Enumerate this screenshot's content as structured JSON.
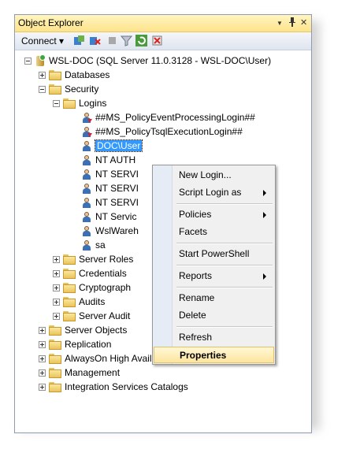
{
  "window": {
    "title": "Object Explorer",
    "dropdown_glyph": "▼",
    "pin_glyph": "ᵽ",
    "close_glyph": "✕"
  },
  "toolbar": {
    "connect_label": "Connect ▾",
    "icons": [
      "connect-object-explorer-icon",
      "disconnect-icon",
      "stop-icon",
      "filter-icon",
      "refresh-icon",
      "delete-icon"
    ]
  },
  "tree": {
    "server": "WSL-DOC (SQL Server 11.0.3128 - WSL-DOC\\User)",
    "nodes": {
      "databases": "Databases",
      "security": "Security",
      "logins": "Logins",
      "login_items": [
        "##MS_PolicyEventProcessingLogin##",
        "##MS_PolicyTsqlExecutionLogin##",
        "DOC\\User",
        "NT AUTH",
        "NT SERVI",
        "NT SERVI",
        "NT SERVI",
        "NT Servic",
        "WslWareh",
        "sa"
      ],
      "security_children": [
        "Server Roles",
        "Credentials",
        "Cryptograph",
        "Audits",
        "Server Audit"
      ],
      "top_level": [
        "Server Objects",
        "Replication",
        "AlwaysOn High Availability",
        "Management",
        "Integration Services Catalogs"
      ]
    }
  },
  "context_menu": {
    "items": [
      "New Login...",
      "Script Login as",
      "Policies",
      "Facets",
      "Start PowerShell",
      "Reports",
      "Rename",
      "Delete",
      "Refresh",
      "Properties"
    ],
    "highlighted": "Properties"
  },
  "colors": {
    "selection": "#3399ff",
    "titlebar": "#fde38b",
    "highlight": "#fde59d"
  }
}
